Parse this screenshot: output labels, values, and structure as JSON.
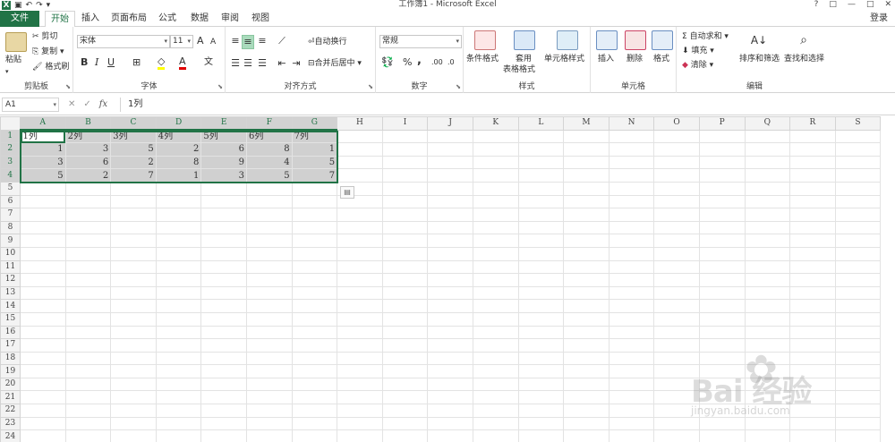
{
  "window": {
    "title": "工作簿1 - Microsoft Excel",
    "help": "?",
    "controls": [
      "□",
      "—",
      "□",
      "✕"
    ]
  },
  "qat": {
    "undo": "↶",
    "redo": "↷",
    "more": "▾"
  },
  "tabs": [
    {
      "label": "文件",
      "kind": "file"
    },
    {
      "label": "开始",
      "kind": "active"
    },
    {
      "label": "插入"
    },
    {
      "label": "页面布局"
    },
    {
      "label": "公式"
    },
    {
      "label": "数据"
    },
    {
      "label": "审阅"
    },
    {
      "label": "视图"
    }
  ],
  "login": "登录",
  "ribbon": {
    "clipboard": {
      "label": "剪贴板",
      "paste": "粘贴",
      "cut": "剪切",
      "copy": "复制 ▾",
      "painter": "格式刷"
    },
    "font": {
      "label": "字体",
      "name": "宋体",
      "size": "11",
      "grow": "A",
      "shrink": "A",
      "bold": "B",
      "italic": "I",
      "underline": "U",
      "wen": "文"
    },
    "align": {
      "label": "对齐方式",
      "wrap": "自动换行",
      "merge": "合并后居中 ▾"
    },
    "number": {
      "label": "数字",
      "format": "常规",
      "percent": "%",
      "comma": ","
    },
    "styles": {
      "label": "样式",
      "cond": "条件格式",
      "table_line1": "套用",
      "table_line2": "表格格式",
      "cell": "单元格样式"
    },
    "cells": {
      "label": "单元格",
      "insert": "插入",
      "delete": "删除",
      "format": "格式"
    },
    "editing": {
      "label": "编辑",
      "autosum": "自动求和 ▾",
      "fill": "填充 ▾",
      "clear": "清除 ▾",
      "sort": "排序和筛选",
      "find": "查找和选择"
    }
  },
  "formula_bar": {
    "namebox": "A1",
    "fx": "fx",
    "value": "1列"
  },
  "columns": [
    "A",
    "B",
    "C",
    "D",
    "E",
    "F",
    "G",
    "H",
    "I",
    "J",
    "K",
    "L",
    "M",
    "N",
    "O",
    "P",
    "Q",
    "R",
    "S"
  ],
  "rows": [
    "1",
    "2",
    "3",
    "4",
    "5",
    "6",
    "7",
    "8",
    "9",
    "10",
    "11",
    "12",
    "13",
    "14",
    "15",
    "16",
    "17",
    "18",
    "19",
    "20",
    "21",
    "22",
    "23",
    "24"
  ],
  "cells": {
    "r1": [
      "1列",
      "2列",
      "3列",
      "4列",
      "5列",
      "6列",
      "7列"
    ],
    "r2": [
      "1",
      "3",
      "5",
      "2",
      "6",
      "8",
      "1"
    ],
    "r3": [
      "3",
      "6",
      "2",
      "8",
      "9",
      "4",
      "5"
    ],
    "r4": [
      "5",
      "2",
      "7",
      "1",
      "3",
      "5",
      "7"
    ]
  },
  "watermark": {
    "brand": "Bai  经验",
    "url": "jingyan.baidu.com"
  }
}
